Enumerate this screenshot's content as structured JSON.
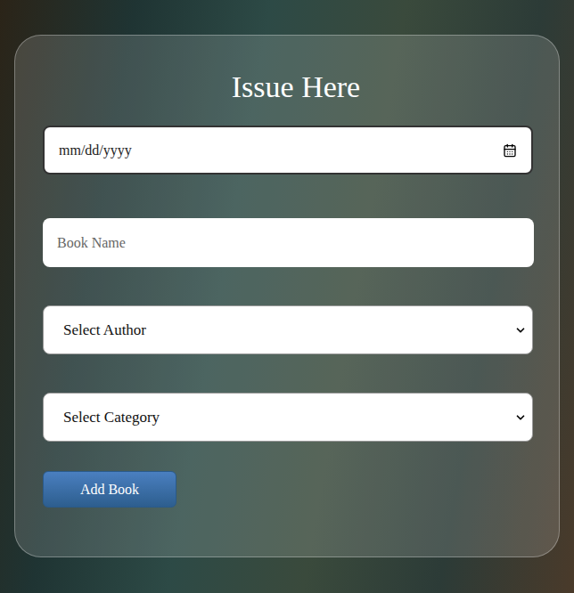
{
  "form": {
    "title": "Issue Here",
    "date_field": {
      "placeholder": "mm/dd/yyyy"
    },
    "book_name_field": {
      "placeholder": "Book Name"
    },
    "author_select": {
      "value": "Select Author"
    },
    "category_select": {
      "value": "Select Category"
    },
    "submit_button": "Add Book"
  }
}
